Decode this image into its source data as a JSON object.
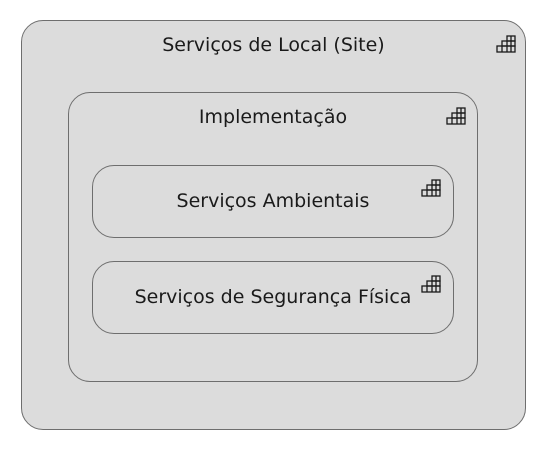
{
  "diagram": {
    "outer": {
      "label": "Serviços de Local (Site)",
      "icon": "grid-icon"
    },
    "middle": {
      "label": "Implementação",
      "icon": "grid-icon"
    },
    "children": [
      {
        "label": "Serviços Ambientais",
        "icon": "grid-icon"
      },
      {
        "label": "Serviços de Segurança Física",
        "icon": "grid-icon"
      }
    ]
  },
  "colors": {
    "box_fill": "#dcdcdc",
    "box_border": "#6e6e6e",
    "text": "#1a1a1a"
  }
}
